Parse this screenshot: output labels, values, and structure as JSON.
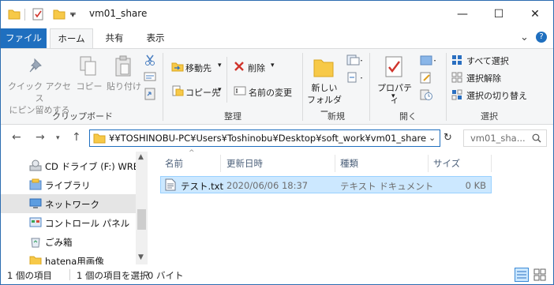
{
  "window": {
    "title": "vm01_share",
    "controls": {
      "minimize": "—",
      "maximize": "☐",
      "close": "✕"
    }
  },
  "tabs": {
    "file": "ファイル",
    "home": "ホーム",
    "share": "共有",
    "view": "表示",
    "collapse_glyph": "⌄",
    "help_glyph": "?"
  },
  "ribbon": {
    "clipboard": {
      "label": "クリップボード",
      "pin_line1": "クイック アクセス",
      "pin_line2": "にピン留めする",
      "copy": "コピー",
      "paste": "貼り付け"
    },
    "organize": {
      "label": "整理",
      "move_to": "移動先",
      "copy_to": "コピー先",
      "delete": "削除",
      "rename": "名前の変更"
    },
    "new": {
      "label": "新規",
      "new_folder_line1": "新しい",
      "new_folder_line2": "フォルダー"
    },
    "open": {
      "label": "開く",
      "properties": "プロパティ"
    },
    "select": {
      "label": "選択",
      "select_all": "すべて選択",
      "select_none": "選択解除",
      "invert": "選択の切り替え"
    },
    "dropdown_glyph": "▾"
  },
  "address": {
    "path": "¥¥TOSHINOBU-PC¥Users¥Toshinobu¥Desktop¥soft_work¥vm01_share",
    "search_placeholder": "vm01_sha..."
  },
  "nav": {
    "items": [
      {
        "label": "CD ドライブ (F:) WREC",
        "icon": "cd-drive-icon"
      },
      {
        "label": "ライブラリ",
        "icon": "library-icon"
      },
      {
        "label": "ネットワーク",
        "icon": "network-icon",
        "selected": true
      },
      {
        "label": "コントロール パネル",
        "icon": "control-panel-icon"
      },
      {
        "label": "ごみ箱",
        "icon": "recycle-bin-icon"
      },
      {
        "label": "hatena用画像",
        "icon": "folder-icon"
      }
    ]
  },
  "columns": {
    "name": "名前",
    "modified": "更新日時",
    "type": "種類",
    "size": "サイズ"
  },
  "files": [
    {
      "name": "テスト.txt",
      "modified": "2020/06/06 18:37",
      "type": "テキスト ドキュメント",
      "size": "0 KB"
    }
  ],
  "status": {
    "count": "1 個の項目",
    "selected": "1 個の項目を選択",
    "size": "0 バイト"
  },
  "colors": {
    "accent": "#1f6fbf",
    "selection": "#cce8ff",
    "ribbon_bg": "#f5f6f7"
  }
}
